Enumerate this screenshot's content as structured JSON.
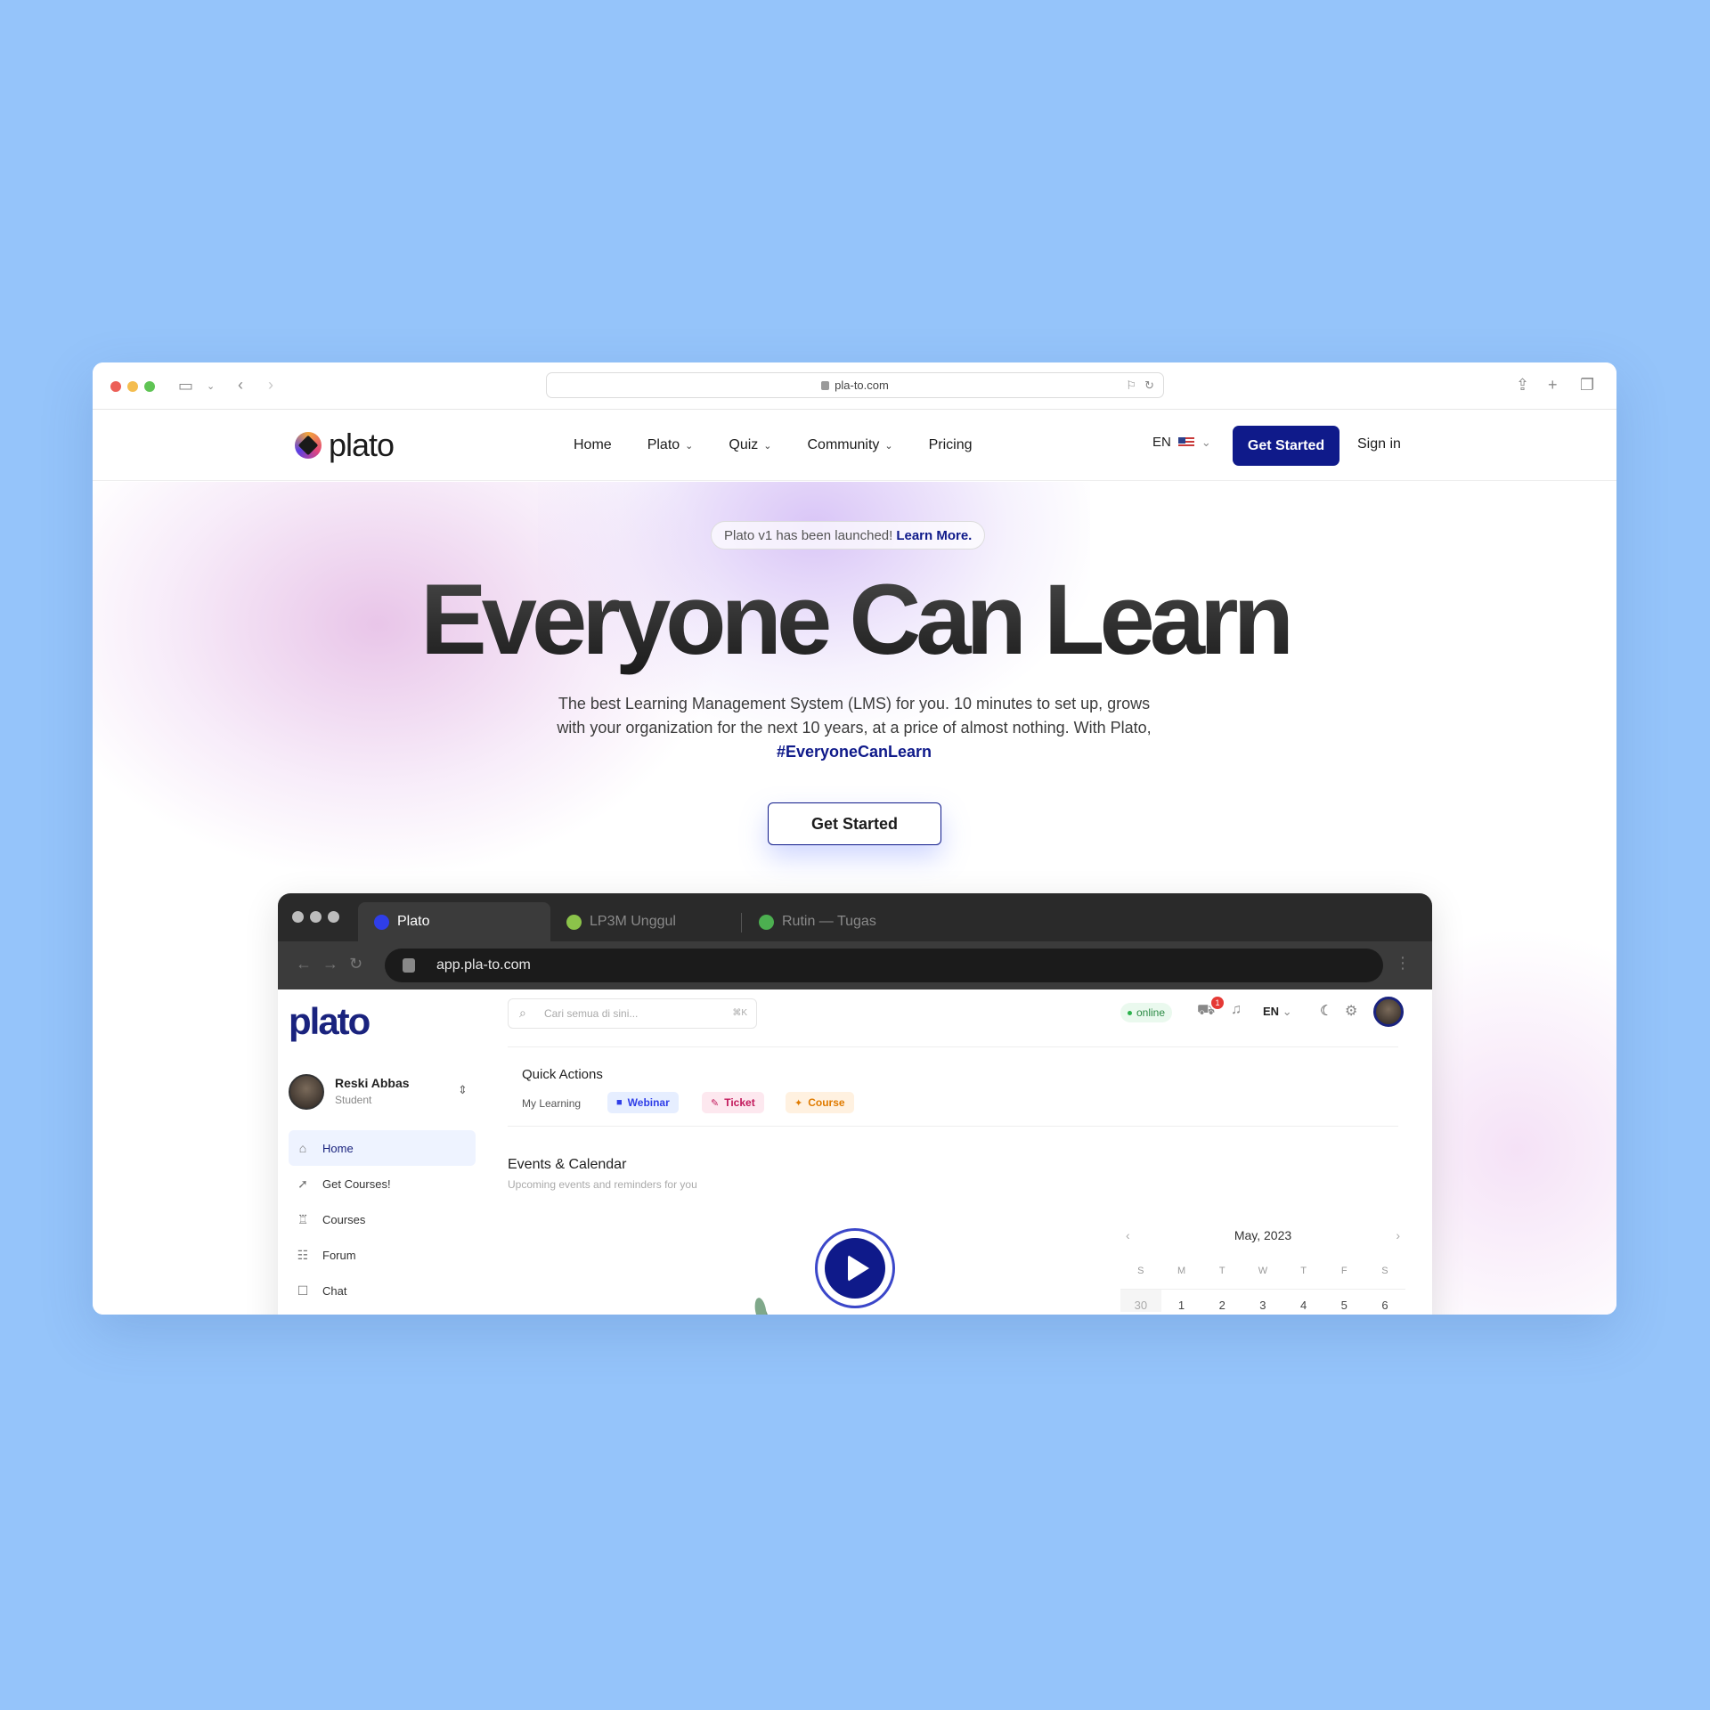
{
  "browser": {
    "url": "pla-to.com"
  },
  "nav": {
    "logo_text": "plato",
    "items": [
      {
        "label": "Home",
        "dropdown": false
      },
      {
        "label": "Plato",
        "dropdown": true
      },
      {
        "label": "Quiz",
        "dropdown": true
      },
      {
        "label": "Community",
        "dropdown": true
      },
      {
        "label": "Pricing",
        "dropdown": false
      }
    ],
    "language": "EN",
    "get_started": "Get Started",
    "sign_in": "Sign in"
  },
  "hero": {
    "announcement": "Plato v1 has been launched!",
    "announcement_link": "Learn More.",
    "title": "Everyone Can Learn",
    "subtitle": "The best Learning Management System (LMS) for you. 10 minutes to set up, grows with your organization for the next 10 years, at a price of almost nothing. With Plato,",
    "hashtag": "#EveryoneCanLearn",
    "cta": "Get Started"
  },
  "app_preview": {
    "tabs": [
      {
        "label": "Plato",
        "color": "#2f3ee8"
      },
      {
        "label": "LP3M Unggul",
        "color": "#8bc34a"
      },
      {
        "label": "Rutin — Tugas",
        "color": "#4caf50"
      }
    ],
    "url": "app.pla-to.com",
    "logo_text": "plato",
    "search_placeholder": "Cari semua di sini...",
    "search_shortcut": "⌘K",
    "status": "online",
    "cart_count": "1",
    "language": "EN",
    "user": {
      "name": "Reski Abbas",
      "role": "Student"
    },
    "sidebar": [
      {
        "label": "Home",
        "icon": "home-icon",
        "glyph": "⌂"
      },
      {
        "label": "Get Courses!",
        "icon": "rocket-icon",
        "glyph": "➚"
      },
      {
        "label": "Courses",
        "icon": "trophy-icon",
        "glyph": "♖"
      },
      {
        "label": "Forum",
        "icon": "forum-icon",
        "glyph": "☷"
      },
      {
        "label": "Chat",
        "icon": "chat-icon",
        "glyph": "☐"
      }
    ],
    "quick_actions": {
      "title": "Quick Actions",
      "my_learning": "My Learning",
      "chips": [
        {
          "label": "Webinar",
          "glyph": "■",
          "bg": "#e6eeff",
          "fg": "#2f3ee8"
        },
        {
          "label": "Ticket",
          "glyph": "✎",
          "bg": "#fde8ef",
          "fg": "#c2185b"
        },
        {
          "label": "Course",
          "glyph": "✦",
          "bg": "#fff1e0",
          "fg": "#e07b00"
        }
      ]
    },
    "events": {
      "title": "Events & Calendar",
      "subtitle": "Upcoming events and reminders for you"
    },
    "calendar": {
      "month": "May, 2023",
      "weekdays": [
        "S",
        "M",
        "T",
        "W",
        "T",
        "F",
        "S"
      ],
      "days": [
        "30",
        "1",
        "2",
        "3",
        "4",
        "5",
        "6"
      ]
    }
  }
}
